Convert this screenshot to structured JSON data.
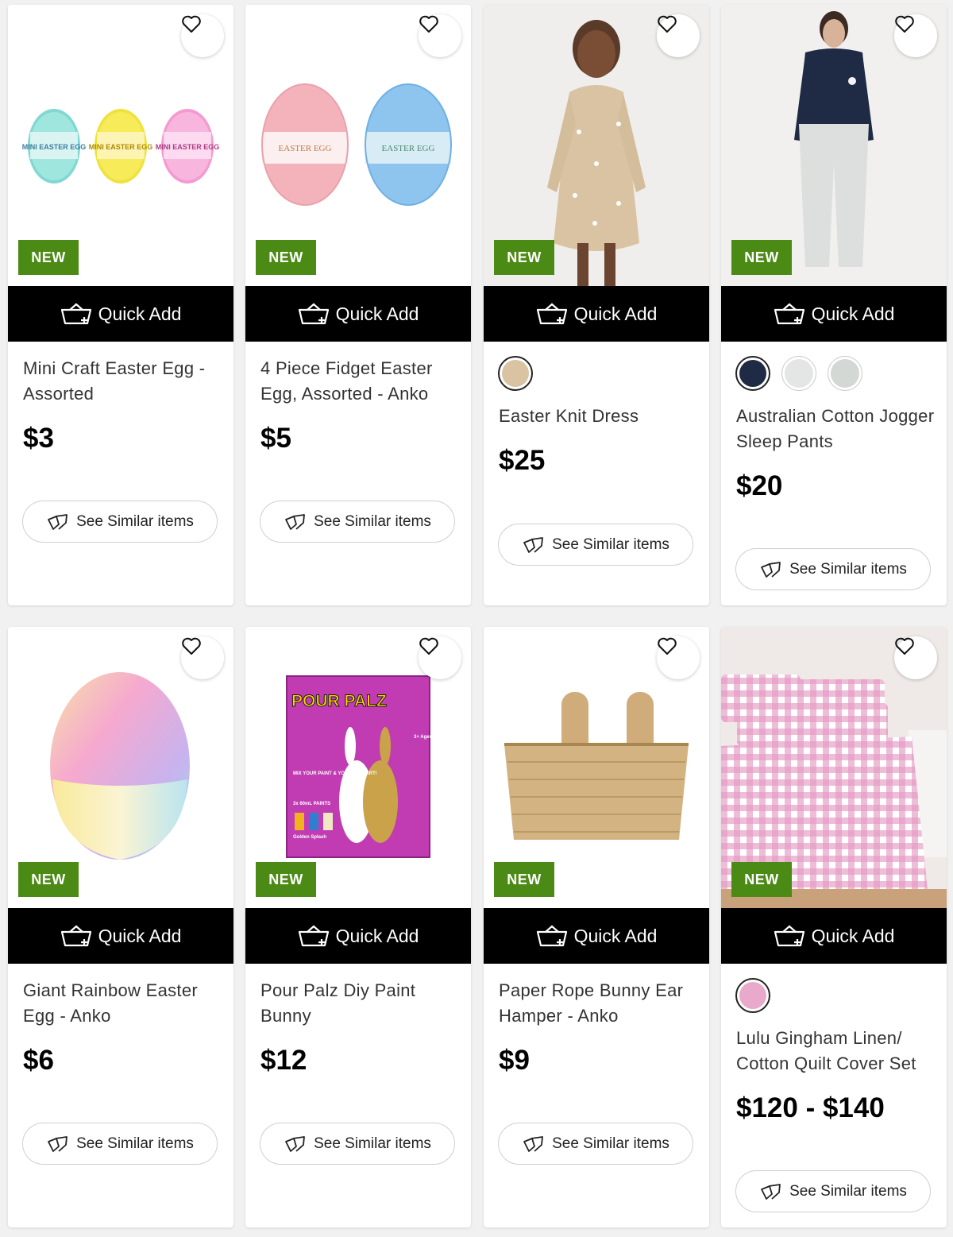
{
  "colors": {
    "badge_bg": "#4b8a14",
    "quick_add_bg": "#000000",
    "page_bg": "#f1f1f1"
  },
  "icons": {
    "favourite": "heart-icon",
    "quick_add": "basket-plus-icon",
    "see_similar": "similar-cards-icon"
  },
  "labels": {
    "quick_add": "Quick Add",
    "see_similar": "See Similar items"
  },
  "products": [
    {
      "name": "Mini Craft Easter Egg - Assorted",
      "price": "$3",
      "badge": "NEW",
      "swatch_count": 0
    },
    {
      "name": "4 Piece Fidget Easter Egg, Assorted - Anko",
      "price": "$5",
      "badge": "NEW",
      "swatch_count": 0
    },
    {
      "name": "Easter Knit Dress",
      "price": "$25",
      "badge": "NEW",
      "swatch_count": 1
    },
    {
      "name": "Australian Cotton Jogger Sleep Pants",
      "price": "$20",
      "badge": "NEW",
      "swatch_count": 3
    },
    {
      "name": "Giant Rainbow Easter Egg - Anko",
      "price": "$6",
      "badge": "NEW",
      "swatch_count": 0
    },
    {
      "name": "Pour Palz Diy Paint Bunny",
      "price": "$12",
      "badge": "NEW",
      "swatch_count": 0
    },
    {
      "name": "Paper Rope Bunny Ear Hamper - Anko",
      "price": "$9",
      "badge": "NEW",
      "swatch_count": 0
    },
    {
      "name": "Lulu Gingham Linen/ Cotton Quilt Cover Set",
      "price": "$120 - $140",
      "badge": "NEW",
      "swatch_count": 1
    }
  ],
  "artwork": {
    "mini_egg_text": "MINI EASTER EGG",
    "fidget_egg_text": "EASTER EGG",
    "pour_palz_brand": "POUR PALZ",
    "pour_palz_mix": "MIX YOUR PAINT & YOUR OWN ART!",
    "pour_palz_paints": "3x 60mL PAINTS",
    "pour_palz_colour": "Golden Splash",
    "pour_palz_age": "3+ Ages"
  }
}
